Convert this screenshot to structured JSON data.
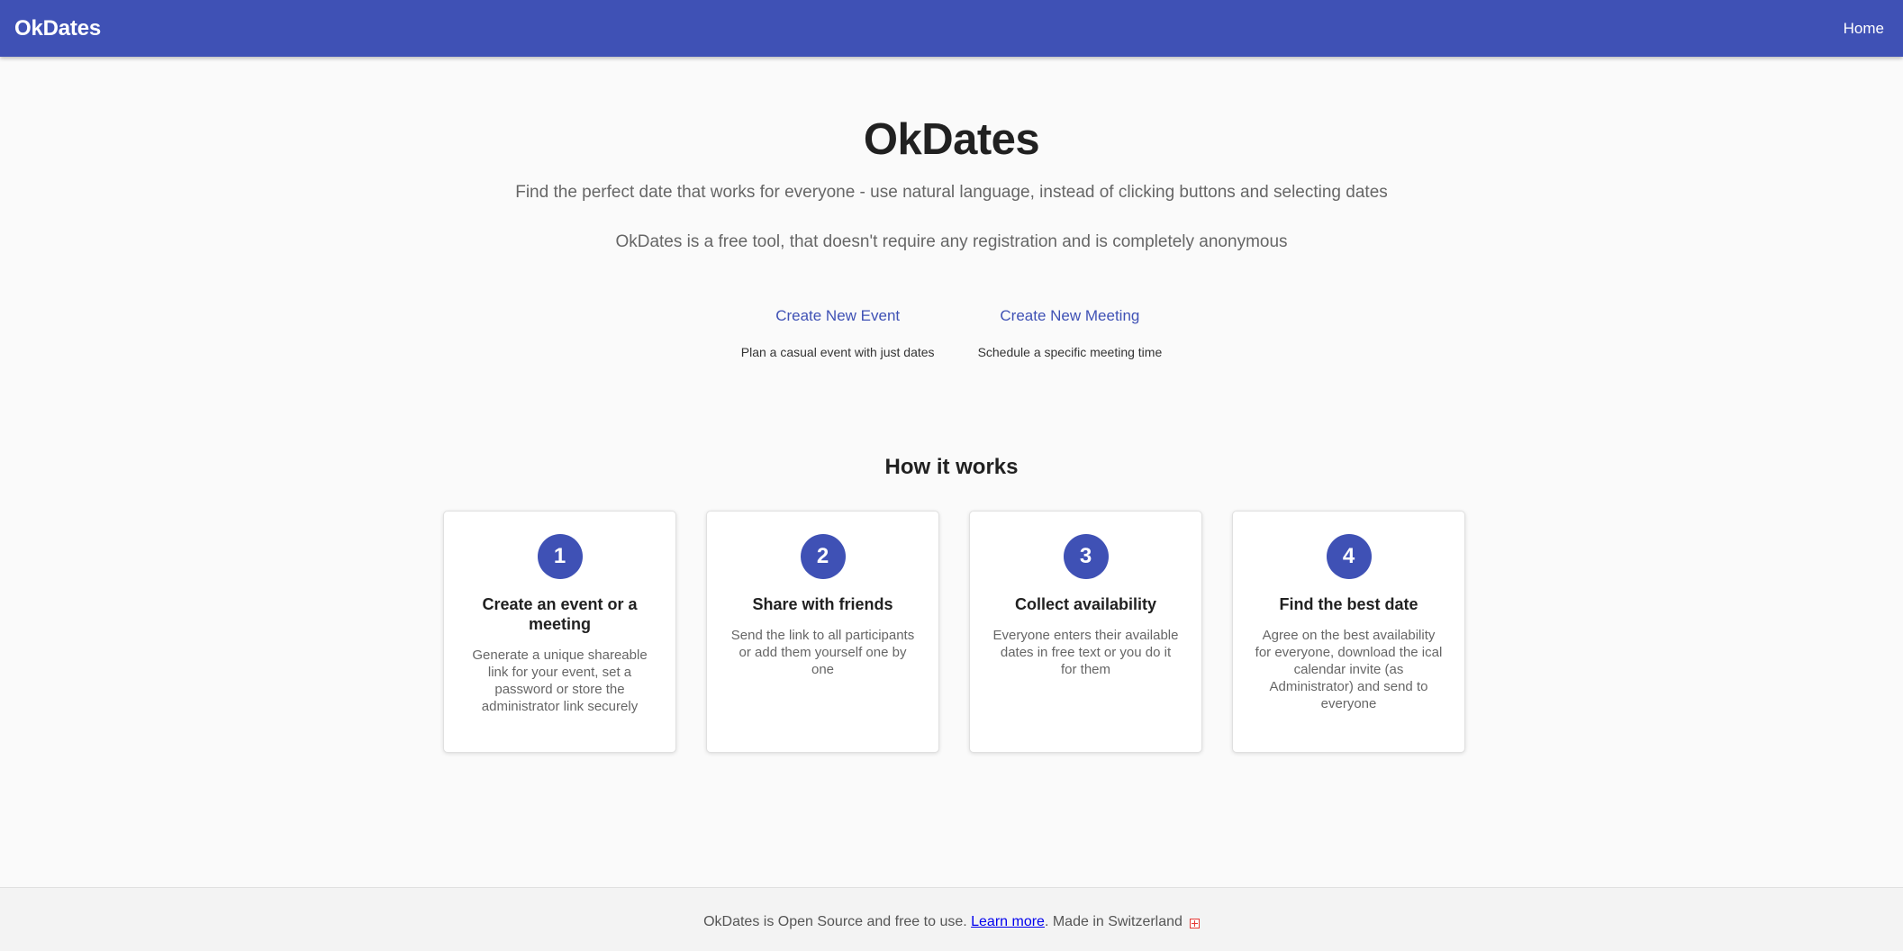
{
  "header": {
    "brand": "OkDates",
    "nav": {
      "home": "Home"
    }
  },
  "hero": {
    "title": "OkDates",
    "subtitle": "Find the perfect date that works for everyone - use natural language, instead of clicking buttons and selecting dates",
    "tagline": "OkDates is a free tool, that doesn't require any registration and is completely anonymous"
  },
  "actions": [
    {
      "label": "Create New Event",
      "description": "Plan a casual event with just dates"
    },
    {
      "label": "Create New Meeting",
      "description": "Schedule a specific meeting time"
    }
  ],
  "how_it_works": {
    "title": "How it works",
    "steps": [
      {
        "number": "1",
        "title": "Create an event or a meeting",
        "description": "Generate a unique shareable link for your event, set a password or store the administrator link securely"
      },
      {
        "number": "2",
        "title": "Share with friends",
        "description": "Send the link to all participants or add them yourself one by one"
      },
      {
        "number": "3",
        "title": "Collect availability",
        "description": "Everyone enters their available dates in free text or you do it for them"
      },
      {
        "number": "4",
        "title": "Find the best date",
        "description": "Agree on the best availability for everyone, download the ical calendar invite (as Administrator) and send to everyone"
      }
    ]
  },
  "footer": {
    "text_before": "OkDates is Open Source and free to use. ",
    "link": "Learn more",
    "text_after": ". Made in Switzerland",
    "flag_icon": "swiss-flag-icon"
  },
  "colors": {
    "primary": "#3f51b5",
    "background": "#fafafa",
    "text_muted": "#666666"
  }
}
